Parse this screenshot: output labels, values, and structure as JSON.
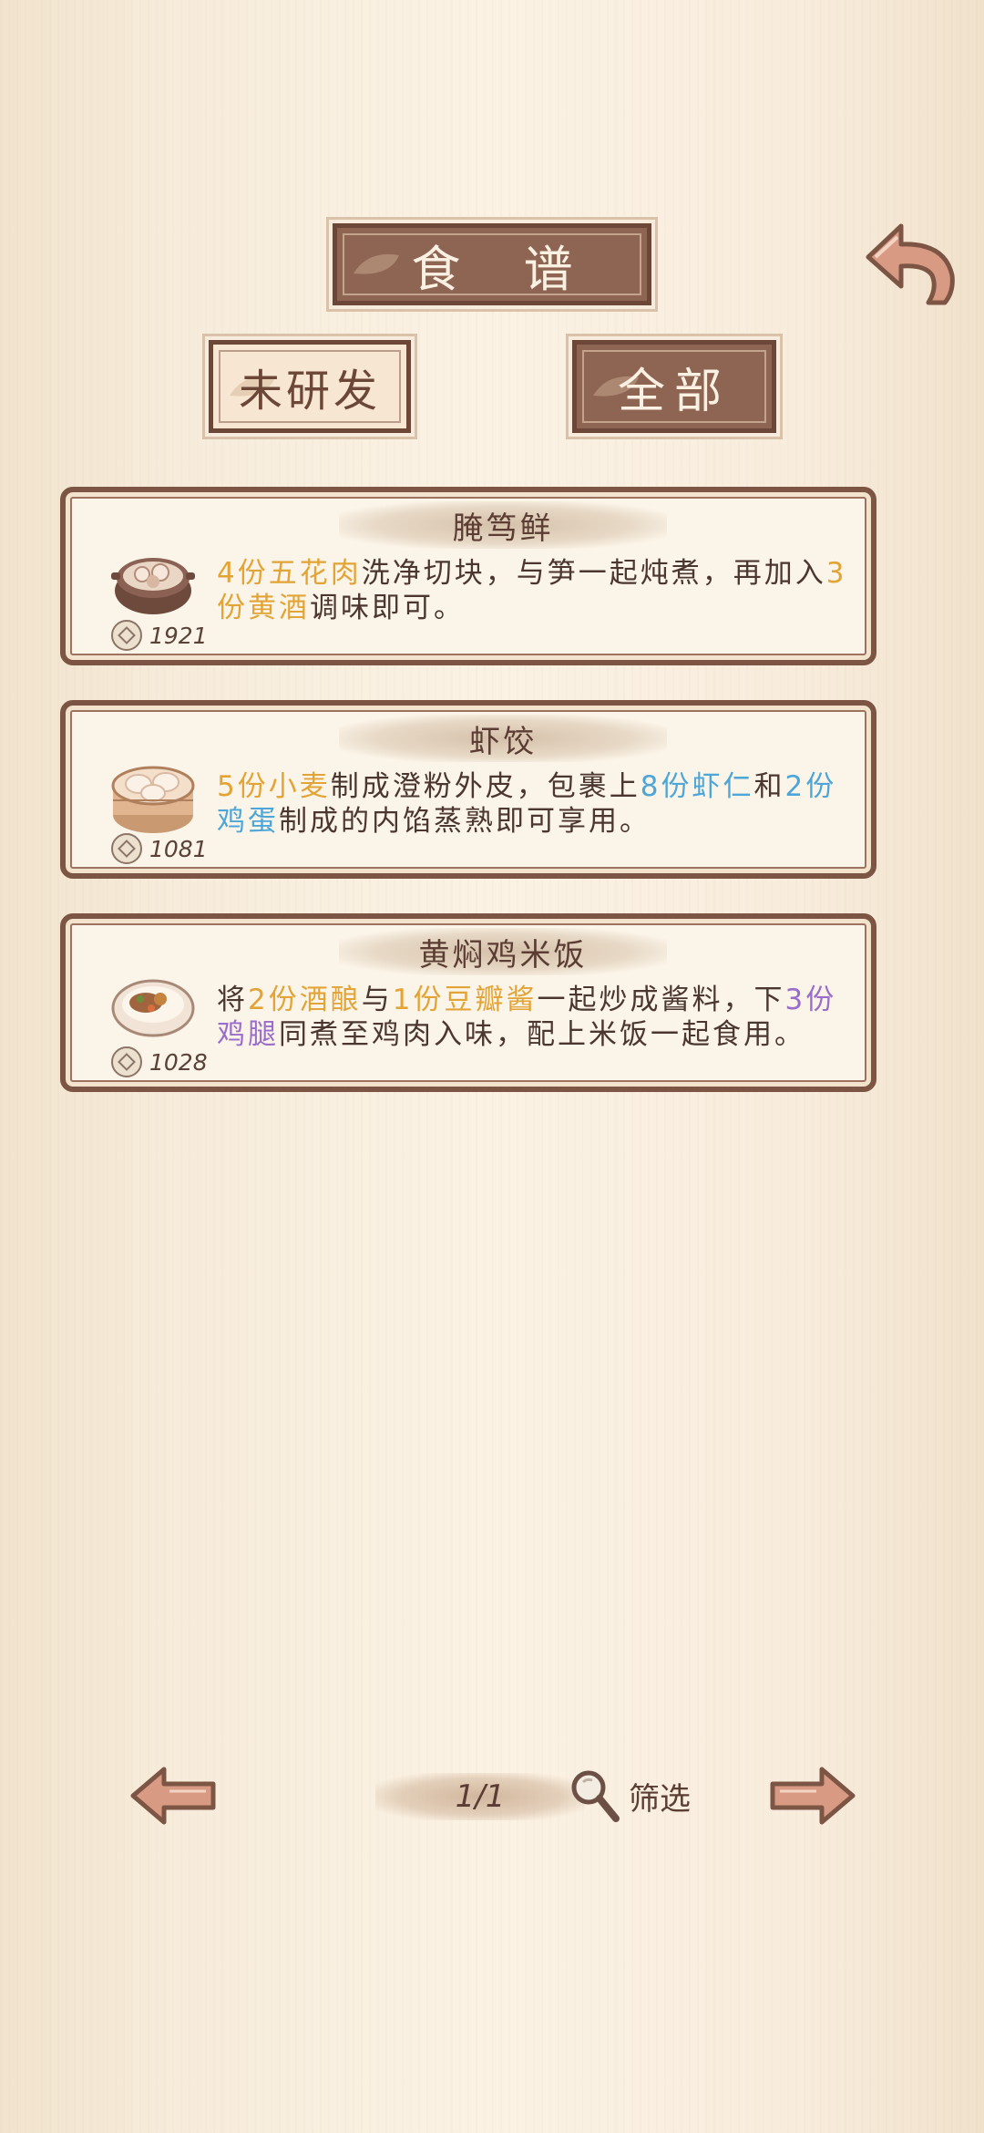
{
  "header": {
    "title": "食 谱"
  },
  "tabs": [
    {
      "label": "未研发",
      "active": false
    },
    {
      "label": "全部",
      "active": true
    }
  ],
  "recipes": [
    {
      "name": "腌笃鲜",
      "price": "1921",
      "desc": [
        {
          "t": "4份五花肉",
          "c": "y"
        },
        {
          "t": "洗净切块，与笋一起炖煮，再加入",
          "c": ""
        },
        {
          "t": "3份黄酒",
          "c": "y"
        },
        {
          "t": "调味即可。",
          "c": ""
        }
      ]
    },
    {
      "name": "虾饺",
      "price": "1081",
      "desc": [
        {
          "t": "5份小麦",
          "c": "y"
        },
        {
          "t": "制成澄粉外皮，包裹上",
          "c": ""
        },
        {
          "t": "8份虾仁",
          "c": "b"
        },
        {
          "t": "和",
          "c": ""
        },
        {
          "t": "2份鸡蛋",
          "c": "b"
        },
        {
          "t": "制成的内馅蒸熟即可享用。",
          "c": ""
        }
      ]
    },
    {
      "name": "黄焖鸡米饭",
      "price": "1028",
      "desc": [
        {
          "t": "将",
          "c": ""
        },
        {
          "t": "2份酒酿",
          "c": "y"
        },
        {
          "t": "与",
          "c": ""
        },
        {
          "t": "1份豆瓣酱",
          "c": "y"
        },
        {
          "t": "一起炒成酱料，下",
          "c": ""
        },
        {
          "t": "3份鸡腿",
          "c": "p"
        },
        {
          "t": "同煮至鸡肉入味，配上米饭一起食用。",
          "c": ""
        }
      ]
    }
  ],
  "pager": {
    "page": "1/1",
    "filter_label": "筛选"
  },
  "colors": {
    "plaque": "#8e6453",
    "border": "#7d5544",
    "yellow": "#e2a436",
    "blue": "#4ea5d7",
    "purple": "#9a6dcb"
  }
}
